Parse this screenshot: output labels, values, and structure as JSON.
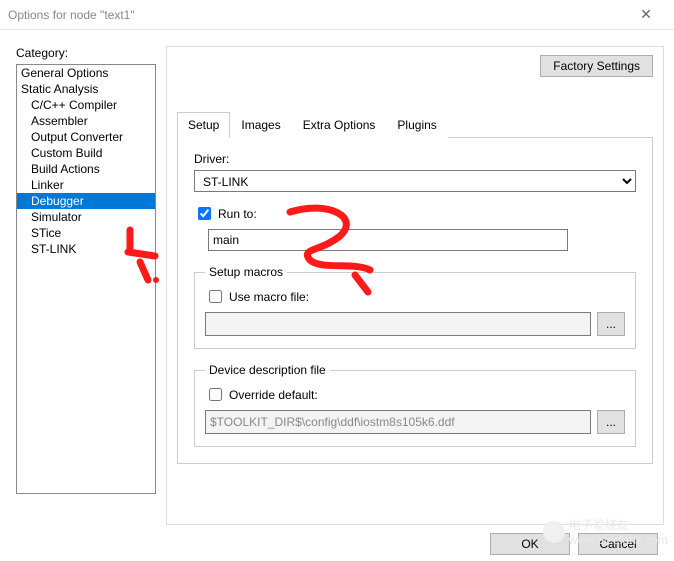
{
  "window": {
    "title": "Options for node \"text1\""
  },
  "left": {
    "label": "Category:",
    "items": [
      {
        "label": "General Options",
        "indent": false
      },
      {
        "label": "Static Analysis",
        "indent": false
      },
      {
        "label": "C/C++ Compiler",
        "indent": true
      },
      {
        "label": "Assembler",
        "indent": true
      },
      {
        "label": "Output Converter",
        "indent": true
      },
      {
        "label": "Custom Build",
        "indent": true
      },
      {
        "label": "Build Actions",
        "indent": true
      },
      {
        "label": "Linker",
        "indent": true
      },
      {
        "label": "Debugger",
        "indent": true,
        "selected": true
      },
      {
        "label": "Simulator",
        "indent": true
      },
      {
        "label": "STice",
        "indent": true
      },
      {
        "label": "ST-LINK",
        "indent": true
      }
    ]
  },
  "right": {
    "factory": "Factory Settings",
    "tabs": [
      {
        "label": "Setup",
        "active": true
      },
      {
        "label": "Images"
      },
      {
        "label": "Extra Options"
      },
      {
        "label": "Plugins"
      }
    ],
    "driver": {
      "label": "Driver:",
      "value": "ST-LINK"
    },
    "runto": {
      "label": "Run to:",
      "checked": true,
      "value": "main"
    },
    "macros": {
      "legend": "Setup macros",
      "use_label": "Use macro file:",
      "use_checked": false,
      "path": ""
    },
    "ddf": {
      "legend": "Device description file",
      "override_label": "Override default:",
      "override_checked": false,
      "path": "$TOOLKIT_DIR$\\config\\ddf\\iostm8s105k6.ddf"
    }
  },
  "footer": {
    "ok": "OK",
    "cancel": "Cancel"
  },
  "watermark": {
    "text": "电子发烧友",
    "url": "www.elecfans.com"
  }
}
